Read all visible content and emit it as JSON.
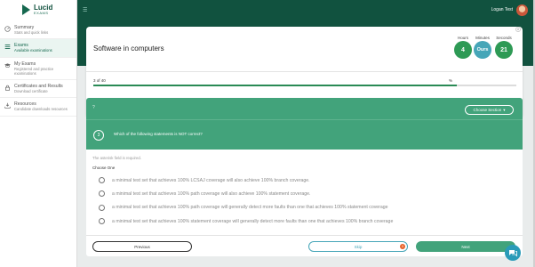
{
  "brand": {
    "name": "Lucid",
    "sub": "EXAMS"
  },
  "sidebar": {
    "items": [
      {
        "title": "Summary",
        "sub": "Stats and quick links"
      },
      {
        "title": "Exams",
        "sub": "Available examinations"
      },
      {
        "title": "My Exams",
        "sub": "Registered and practice examinations"
      },
      {
        "title": "Certificates and Results",
        "sub": "Download certificate"
      },
      {
        "title": "Resources",
        "sub": "Candidate downloads resources"
      }
    ]
  },
  "topbar": {
    "user_name": "Logan Test"
  },
  "exam": {
    "title": "Software in computers",
    "timer": {
      "hours_label": "Hours",
      "hours": "4",
      "minutes_label": "Minutes",
      "minutes": "Ours",
      "seconds_label": "Seconds",
      "seconds": "21"
    },
    "progress_text": "3 of 40",
    "progress_pct_label": "%",
    "progress_fraction": 0.86
  },
  "question": {
    "mark": "?",
    "section_button": "Choose Section",
    "number": "3",
    "text": "Which of the following statements is NOT correct?",
    "required_note": "The asterisk field is required.",
    "choose_label": "Choose One",
    "options": [
      "a minimal test set that achieves 100% LCSAJ coverage will also achieve 100% branch coverage.",
      "a minimal test set that achieves 100% path coverage will also achieve 100% statement coverage.",
      "a minimal test set that achieves 100% path coverage will generally detect more faults than one that achieves 100% statement coverage",
      "a minimal test set that achieves 100% statement coverage will generally detect more faults than one that achieves 100% branch coverage"
    ]
  },
  "buttons": {
    "previous": "Previous",
    "skip": "Skip",
    "skip_badge": "0",
    "next": "Next"
  },
  "colors": {
    "brand_dark": "#11523f",
    "accent": "#42a37b",
    "timer_green": "#2e9a55",
    "skip_blue": "#46a6b8"
  }
}
